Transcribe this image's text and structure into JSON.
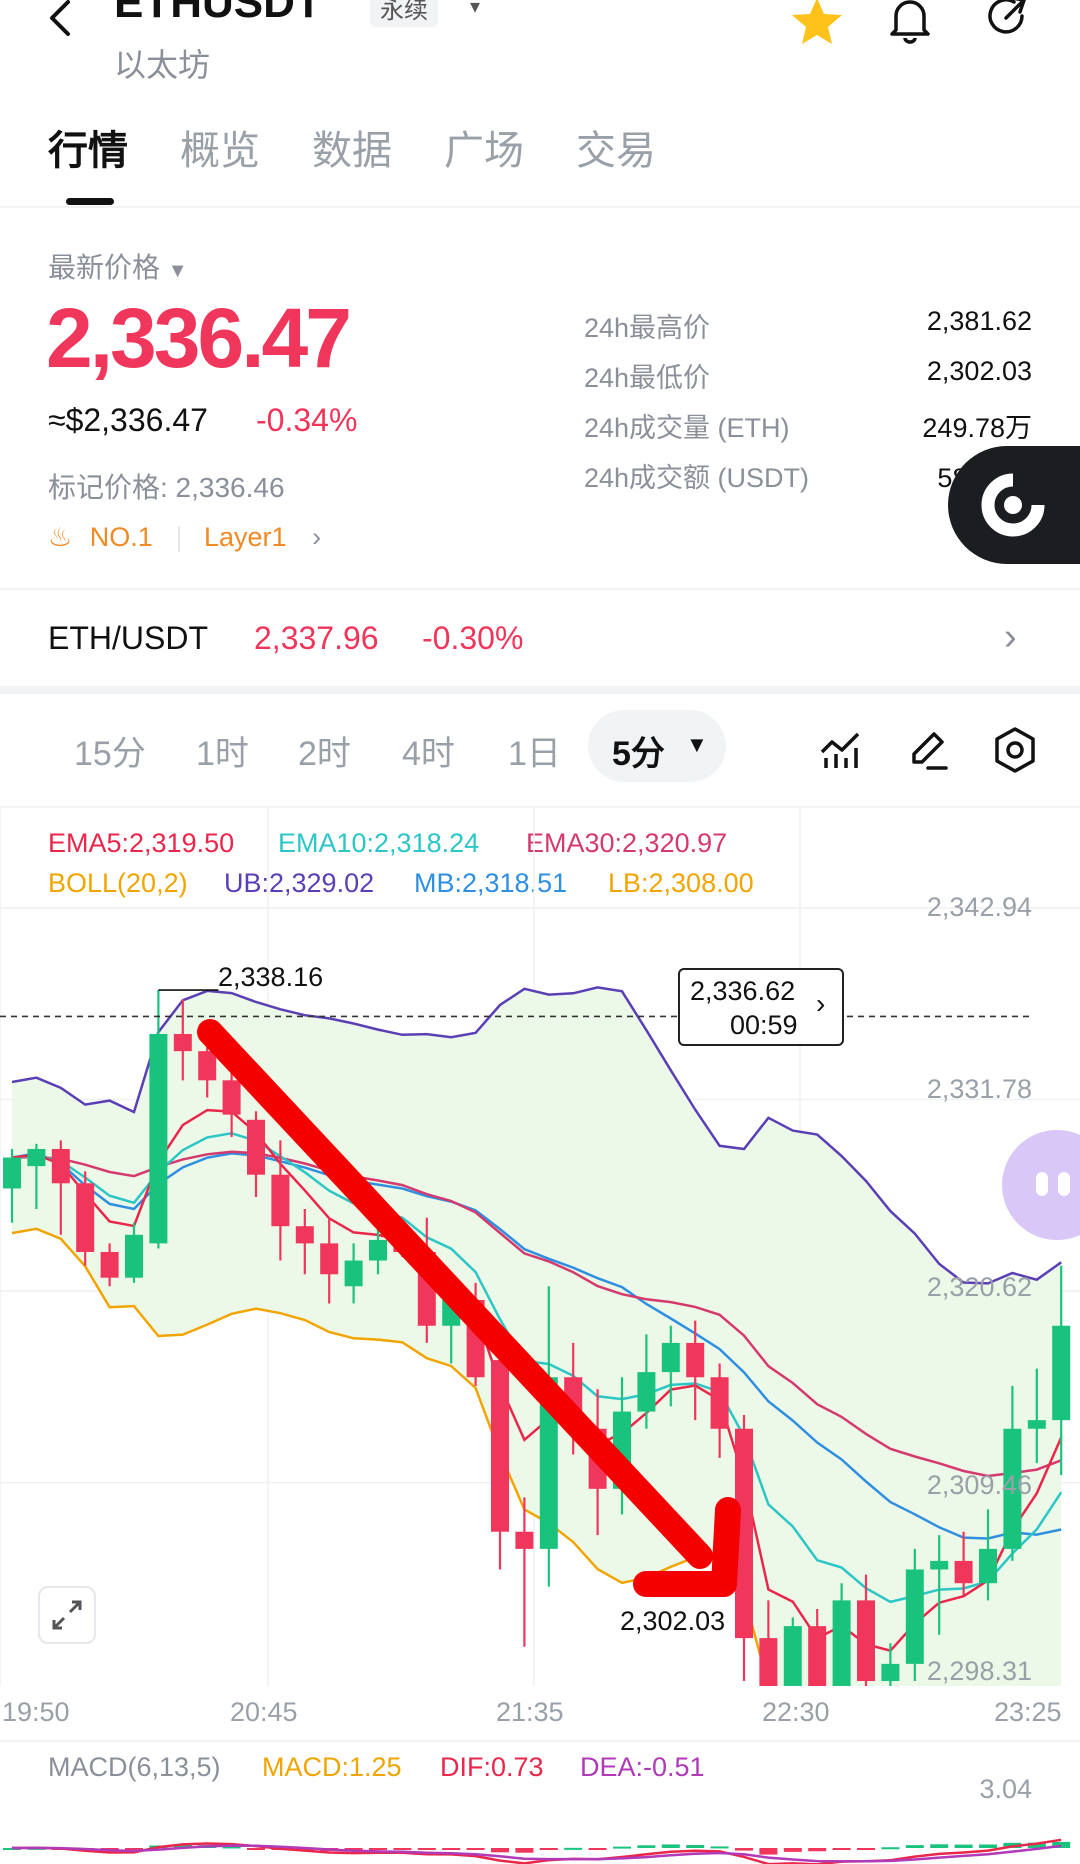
{
  "header": {
    "symbol": "ETHUSDT",
    "badge": "永续",
    "subtitle": "以太坊"
  },
  "tabs": [
    "行情",
    "概览",
    "数据",
    "广场",
    "交易"
  ],
  "price_panel": {
    "label": "最新价格",
    "last_price": "2,336.47",
    "usd_price": "≈$2,336.47",
    "change": "-0.34%",
    "mark_price": "标记价格: 2,336.46",
    "rank": "NO.1",
    "category": "Layer1",
    "stats": [
      {
        "label": "24h最高价",
        "value": "2,381.62"
      },
      {
        "label": "24h最低价",
        "value": "2,302.03"
      },
      {
        "label": "24h成交量 (ETH)",
        "value": "249.78万"
      },
      {
        "label": "24h成交额 (USDT)",
        "value": "58.36亿"
      }
    ]
  },
  "spot_row": {
    "pair": "ETH/USDT",
    "price": "2,337.96",
    "change": "-0.30%"
  },
  "timeframes": [
    "15分",
    "1时",
    "2时",
    "4时",
    "1日"
  ],
  "selected_timeframe": "5分",
  "indicators": {
    "ema5": "EMA5:2,319.50",
    "ema10": "EMA10:2,318.24",
    "ema30": "EMA30:2,320.97",
    "boll": "BOLL(20,2)",
    "ub": "UB:2,329.02",
    "mb": "MB:2,318.51",
    "lb": "LB:2,308.00"
  },
  "chart": {
    "high_label": "2,338.16",
    "low_label": "2,302.03",
    "current_price_tag": "2,336.62",
    "countdown": "00:59",
    "y_ticks": [
      "2,342.94",
      "2,331.78",
      "2,320.62",
      "2,309.46",
      "2,298.31"
    ],
    "x_ticks": [
      "19:50",
      "20:45",
      "21:35",
      "22:30",
      "23:25"
    ]
  },
  "macd": {
    "label": "MACD(6,13,5)",
    "macd": "MACD:1.25",
    "dif": "DIF:0.73",
    "dea": "DEA:-0.51",
    "max": "3.04"
  },
  "colors": {
    "up": "#19c37d",
    "down": "#f0365b",
    "ema5": "#e8274b",
    "ema10": "#2cc6c6",
    "ema30": "#d43a6e",
    "boll": "#f0a500",
    "ub": "#5b3fb5",
    "mb": "#2f8fe0",
    "lb": "#f0a500",
    "arrow": "#f40000"
  },
  "chart_data": {
    "type": "candlestick",
    "candles": [
      {
        "o": 2326.6,
        "h": 2328.9,
        "l": 2324.6,
        "c": 2328.4
      },
      {
        "o": 2327.9,
        "h": 2329.2,
        "l": 2325.4,
        "c": 2328.9
      },
      {
        "o": 2328.9,
        "h": 2329.4,
        "l": 2323.9,
        "c": 2326.9
      },
      {
        "o": 2326.9,
        "h": 2327.6,
        "l": 2322.1,
        "c": 2322.9
      },
      {
        "o": 2322.9,
        "h": 2323.4,
        "l": 2320.9,
        "c": 2321.4
      },
      {
        "o": 2321.4,
        "h": 2324.6,
        "l": 2321.1,
        "c": 2323.9
      },
      {
        "o": 2323.4,
        "h": 2338.16,
        "l": 2323.1,
        "c": 2335.6
      },
      {
        "o": 2335.6,
        "h": 2337.6,
        "l": 2332.9,
        "c": 2334.6
      },
      {
        "o": 2334.6,
        "h": 2335.6,
        "l": 2331.9,
        "c": 2332.9
      },
      {
        "o": 2332.9,
        "h": 2333.4,
        "l": 2329.6,
        "c": 2330.9
      },
      {
        "o": 2330.6,
        "h": 2331.1,
        "l": 2326.1,
        "c": 2327.4
      },
      {
        "o": 2327.4,
        "h": 2329.4,
        "l": 2322.4,
        "c": 2324.4
      },
      {
        "o": 2324.4,
        "h": 2325.4,
        "l": 2321.6,
        "c": 2323.4
      },
      {
        "o": 2323.4,
        "h": 2324.9,
        "l": 2319.9,
        "c": 2321.6
      },
      {
        "o": 2320.9,
        "h": 2323.4,
        "l": 2319.9,
        "c": 2322.4
      },
      {
        "o": 2322.4,
        "h": 2325.4,
        "l": 2321.6,
        "c": 2323.6
      },
      {
        "o": 2323.6,
        "h": 2324.6,
        "l": 2322.6,
        "c": 2322.9
      },
      {
        "o": 2322.9,
        "h": 2324.9,
        "l": 2317.6,
        "c": 2318.6
      },
      {
        "o": 2318.6,
        "h": 2320.9,
        "l": 2316.4,
        "c": 2320.1
      },
      {
        "o": 2320.1,
        "h": 2321.1,
        "l": 2315.1,
        "c": 2315.6
      },
      {
        "o": 2316.6,
        "h": 2318.6,
        "l": 2304.4,
        "c": 2306.6
      },
      {
        "o": 2306.6,
        "h": 2308.6,
        "l": 2299.9,
        "c": 2305.6
      },
      {
        "o": 2305.6,
        "h": 2320.9,
        "l": 2303.4,
        "c": 2315.6
      },
      {
        "o": 2315.6,
        "h": 2317.6,
        "l": 2311.1,
        "c": 2312.6
      },
      {
        "o": 2312.6,
        "h": 2314.9,
        "l": 2306.4,
        "c": 2309.1
      },
      {
        "o": 2309.1,
        "h": 2315.6,
        "l": 2307.6,
        "c": 2313.6
      },
      {
        "o": 2313.6,
        "h": 2318.1,
        "l": 2312.6,
        "c": 2315.9
      },
      {
        "o": 2315.9,
        "h": 2318.6,
        "l": 2313.9,
        "c": 2317.6
      },
      {
        "o": 2317.6,
        "h": 2318.9,
        "l": 2313.1,
        "c": 2315.6
      },
      {
        "o": 2315.6,
        "h": 2316.4,
        "l": 2310.9,
        "c": 2312.6
      },
      {
        "o": 2312.6,
        "h": 2313.4,
        "l": 2297.9,
        "c": 2300.4
      },
      {
        "o": 2300.4,
        "h": 2302.6,
        "l": 2288.9,
        "c": 2290.4
      },
      {
        "o": 2290.4,
        "h": 2301.6,
        "l": 2290.1,
        "c": 2301.1
      },
      {
        "o": 2301.1,
        "h": 2302.1,
        "l": 2294.6,
        "c": 2296.1
      },
      {
        "o": 2296.1,
        "h": 2303.6,
        "l": 2294.9,
        "c": 2302.6
      },
      {
        "o": 2302.6,
        "h": 2304.1,
        "l": 2297.1,
        "c": 2297.9
      },
      {
        "o": 2297.9,
        "h": 2300.1,
        "l": 2296.1,
        "c": 2298.9
      },
      {
        "o": 2298.9,
        "h": 2305.6,
        "l": 2297.9,
        "c": 2304.4
      },
      {
        "o": 2304.4,
        "h": 2306.4,
        "l": 2300.6,
        "c": 2304.9
      },
      {
        "o": 2304.9,
        "h": 2306.6,
        "l": 2302.9,
        "c": 2303.6
      },
      {
        "o": 2303.6,
        "h": 2307.9,
        "l": 2302.6,
        "c": 2305.6
      },
      {
        "o": 2305.6,
        "h": 2315.1,
        "l": 2304.9,
        "c": 2312.6
      },
      {
        "o": 2312.6,
        "h": 2316.1,
        "l": 2310.6,
        "c": 2313.1
      },
      {
        "o": 2313.1,
        "h": 2322.1,
        "l": 2309.9,
        "c": 2318.6
      }
    ],
    "ylim": [
      2298.31,
      2342.94
    ]
  }
}
